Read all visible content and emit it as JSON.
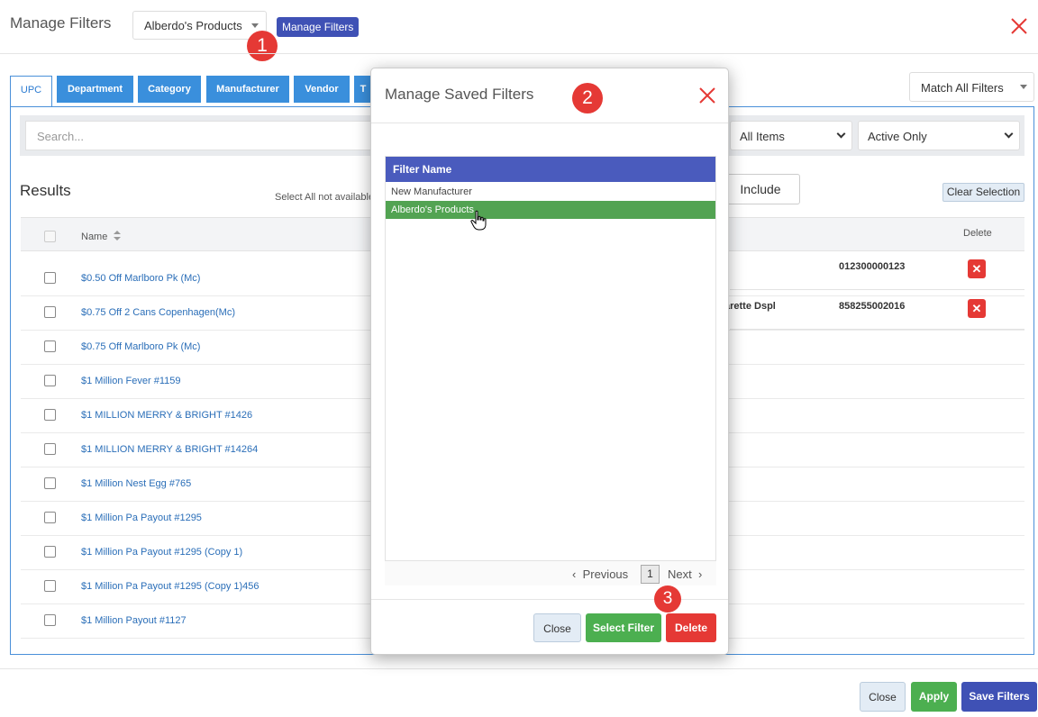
{
  "header": {
    "title": "Manage Filters",
    "filter_select_value": "Alberdo's Products",
    "manage_button_label": "Manage Filters"
  },
  "annotations": [
    "1",
    "2",
    "3"
  ],
  "tabs": [
    {
      "label": "UPC",
      "active": true
    },
    {
      "label": "Department"
    },
    {
      "label": "Category"
    },
    {
      "label": "Manufacturer"
    },
    {
      "label": "Vendor"
    },
    {
      "label": "T"
    }
  ],
  "match_select_value": "Match All Filters",
  "search": {
    "placeholder": "Search..."
  },
  "items_select_value": "All Items",
  "status_select_value": "Active Only",
  "results": {
    "title": "Results",
    "select_all_text": "Select All not available",
    "include_label": "Include",
    "clear_label": "Clear Selection",
    "name_header": "Name",
    "delete_header": "Delete",
    "rows": [
      "$0.50 Off Marlboro Pk (Mc)",
      "$0.75 Off 2 Cans Copenhagen(Mc)",
      "$0.75 Off Marlboro Pk (Mc)",
      "$1 Million Fever #1159",
      "$1 MILLION MERRY & BRIGHT #1426",
      "$1 MILLION MERRY & BRIGHT #14264",
      "$1 Million Nest Egg #765",
      "$1 Million Pa Payout #1295",
      "$1 Million Pa Payout #1295 (Copy 1)",
      "$1 Million Pa Payout #1295 (Copy 1)456",
      "$1 Million Payout #1127"
    ],
    "selected": [
      {
        "description": "",
        "code": "012300000123"
      },
      {
        "description": "arette Dspl",
        "code": "858255002016"
      }
    ]
  },
  "modal": {
    "title": "Manage Saved Filters",
    "list_header": "Filter Name",
    "items": [
      "New Manufacturer",
      "Alberdo's Products"
    ],
    "selected_index": 1,
    "pager": {
      "previous": "Previous",
      "page": "1",
      "next": "Next"
    },
    "close_label": "Close",
    "select_label": "Select Filter",
    "delete_label": "Delete"
  },
  "footer": {
    "close_label": "Close",
    "apply_label": "Apply",
    "save_label": "Save Filters"
  },
  "colors": {
    "primary": "#3f51b5",
    "tab_blue": "#3a8fdc",
    "success": "#52a352",
    "danger": "#e53935",
    "link": "#2a6eb8"
  }
}
